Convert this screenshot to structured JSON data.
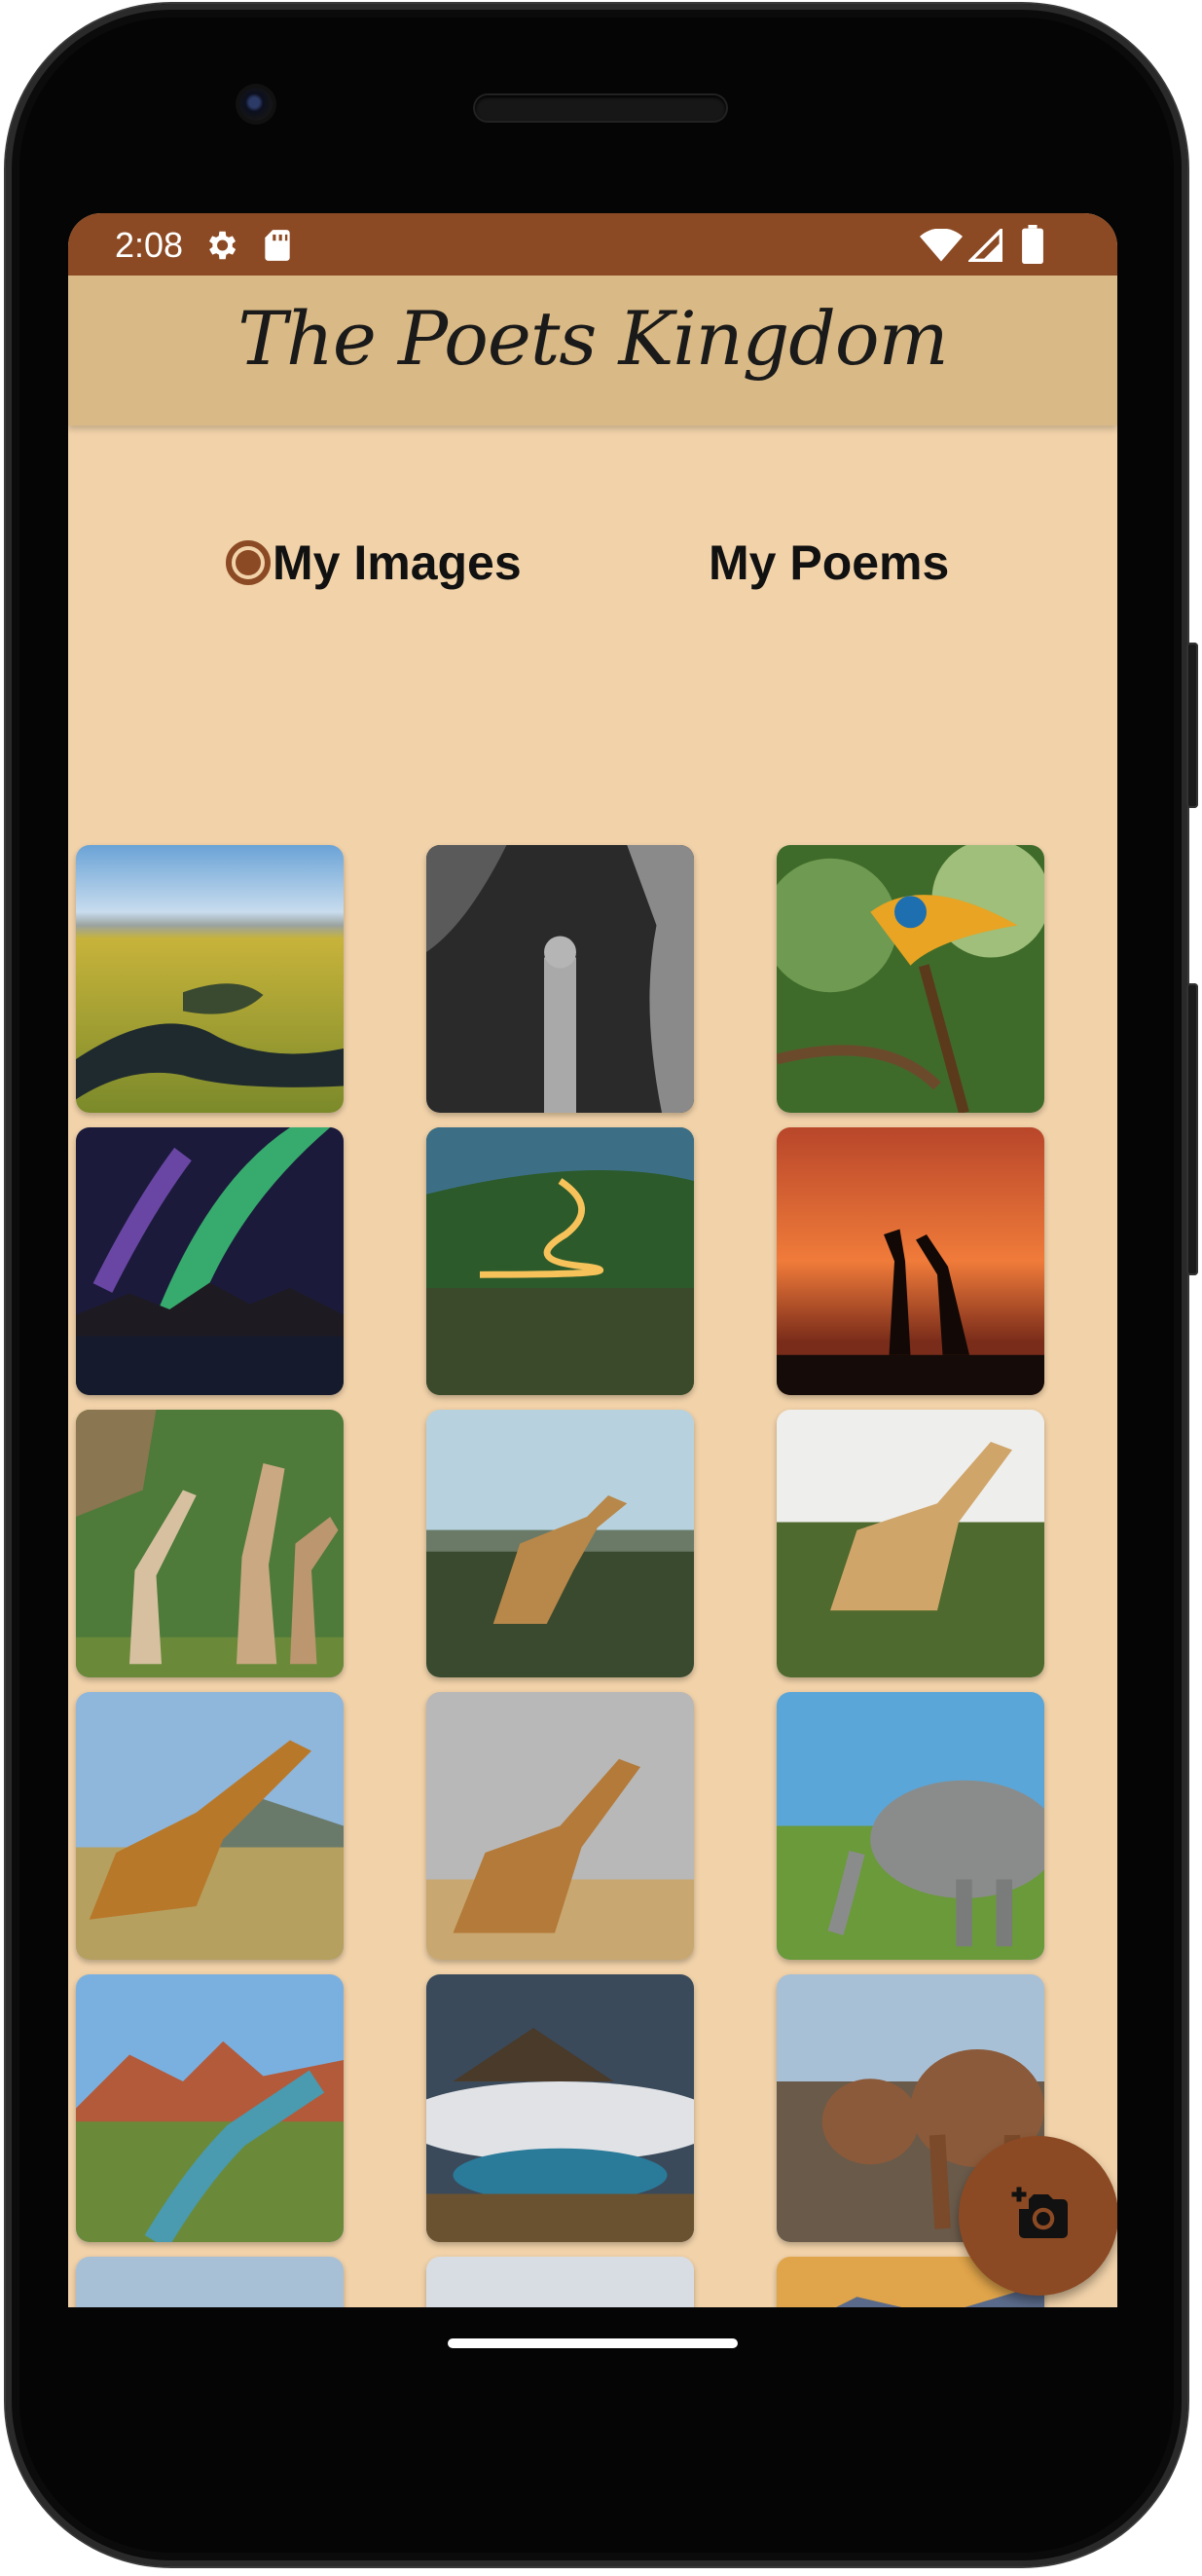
{
  "status_bar": {
    "time": "2:08",
    "icons": [
      "gear-icon",
      "sd-card-icon",
      "wifi-icon",
      "signal-icon",
      "battery-icon"
    ]
  },
  "app_bar": {
    "title": "The Poets Kingdom"
  },
  "tabs": [
    {
      "label": "My Images",
      "selected": true
    },
    {
      "label": "My Poems",
      "selected": false
    }
  ],
  "gallery": [
    {
      "subject": "river-valley-landscape"
    },
    {
      "subject": "stone-statue-cave"
    },
    {
      "subject": "macaw-parrot"
    },
    {
      "subject": "northern-lights"
    },
    {
      "subject": "winding-road-night"
    },
    {
      "subject": "giraffes-sunset"
    },
    {
      "subject": "giraffes-forest"
    },
    {
      "subject": "giraffe-walking"
    },
    {
      "subject": "giraffe-grass"
    },
    {
      "subject": "giraffe-mountain"
    },
    {
      "subject": "giraffe-savanna"
    },
    {
      "subject": "elephant-grass"
    },
    {
      "subject": "canyon-river"
    },
    {
      "subject": "volcano-clouds"
    },
    {
      "subject": "elephants-bush"
    },
    {
      "subject": "elephants-bush-2"
    },
    {
      "subject": "elephant-plain"
    },
    {
      "subject": "hills-sunset"
    }
  ],
  "fab": {
    "icon": "add-photo-camera-icon"
  },
  "colors": {
    "primary": "#8c4a24",
    "app_bar": "#d9b985",
    "background": "#f1d2a9"
  }
}
